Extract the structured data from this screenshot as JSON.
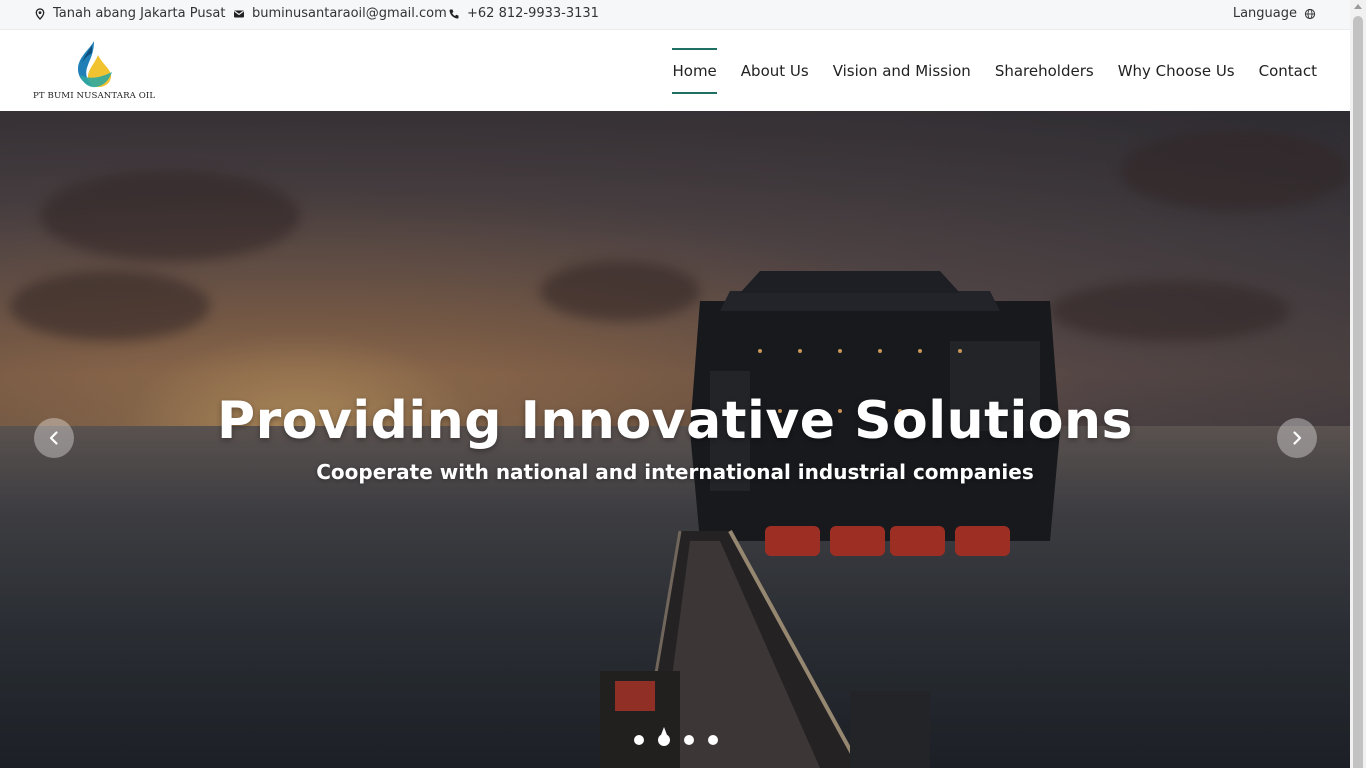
{
  "topbar": {
    "address": "Tanah abang Jakarta Pusat",
    "address_icon": "location-pin-icon",
    "email": "buminusantaraoil@gmail.com",
    "email_icon": "envelope-icon",
    "phone": "+62 812-9933-3131",
    "phone_icon": "phone-icon",
    "language_label": "Language",
    "language_icon": "globe-icon"
  },
  "brand": {
    "logo_text": "PT BUMI NUSANTARA OIL",
    "colors": {
      "drop_blue": "#1f7fb6",
      "drop_yellow": "#f2c330",
      "drop_teal": "#2fa8a0"
    }
  },
  "nav": {
    "items": [
      {
        "label": "Home",
        "active": true
      },
      {
        "label": "About Us",
        "active": false
      },
      {
        "label": "Vision and Mission",
        "active": false
      },
      {
        "label": "Shareholders",
        "active": false
      },
      {
        "label": "Why Choose Us",
        "active": false
      },
      {
        "label": "Contact",
        "active": false
      }
    ],
    "active_color": "#1f6f63"
  },
  "hero": {
    "title": "Providing Innovative Solutions",
    "subtitle": "Cooperate with national and international industrial companies",
    "prev_icon": "chevron-left-icon",
    "next_icon": "chevron-right-icon",
    "slide_count": 4,
    "active_slide": 2
  }
}
